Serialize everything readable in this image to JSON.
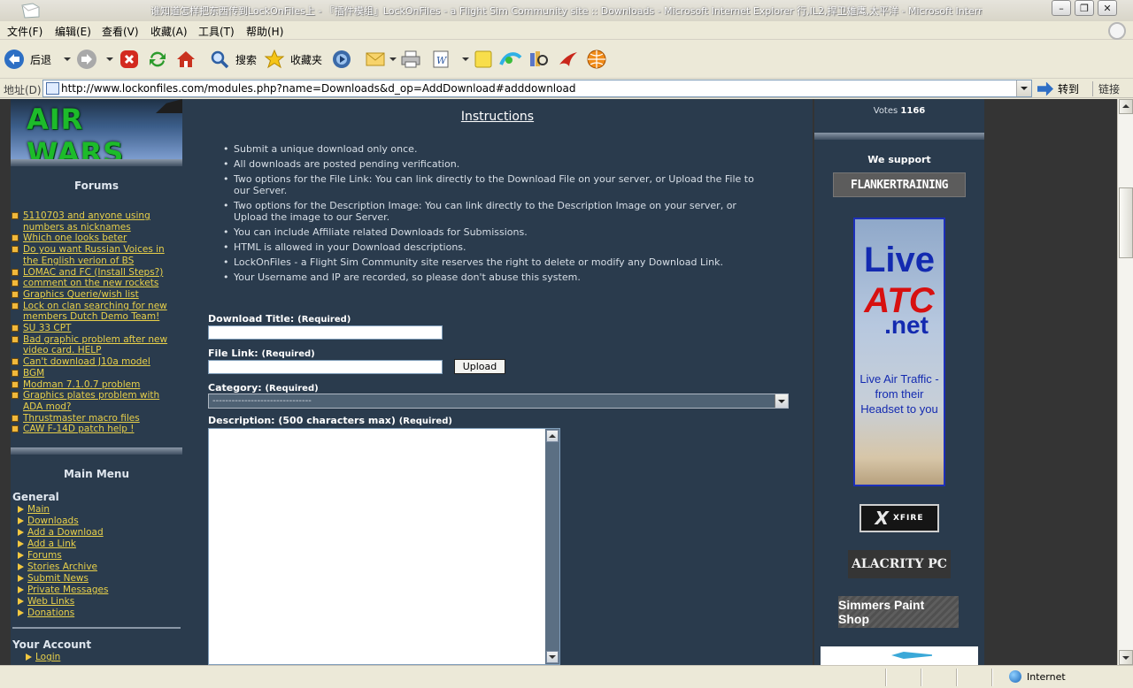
{
  "window": {
    "title": "谁知道怎样把东西传到LockOnFiles上 - 『插件模组』LockOnFiles - a Flight Sim Community site :: Downloads - Microsoft Internet Explorer 行,IL2,捍卫雄鹰,太平洋 - Microsoft Internet Explorer"
  },
  "menubar": [
    "文件(F)",
    "编辑(E)",
    "查看(V)",
    "收藏(A)",
    "工具(T)",
    "帮助(H)"
  ],
  "toolbar": {
    "back_label": "后退",
    "search_label": "搜索",
    "favorites_label": "收藏夹"
  },
  "address": {
    "label": "地址(D)",
    "url": "http://www.lockonfiles.com/modules.php?name=Downloads&d_op=AddDownload#adddownload",
    "go_label": "转到",
    "links_label": "链接"
  },
  "left": {
    "logo_text": "AIR WARS",
    "forums_title": "Forums",
    "forum_items": [
      "5110703 and anyone using numbers as nicknames",
      "Which one looks beter",
      "Do you want Russian Voices in the English verion of BS",
      "LOMAC and FC (Install Steps?)",
      "comment on the new rockets",
      "Graphics Querie/wish list",
      "Lock on clan searching for new members Dutch Demo Team!",
      "SU 33 CPT",
      "Bad graphic problem after new video card. HELP",
      "Can't download J10a model",
      "BGM",
      "Modman 7.1.0.7 problem",
      "Graphics plates problem with ADA mod?",
      "Thrustmaster macro files",
      "CAW F-14D patch help !"
    ],
    "main_menu_title": "Main Menu",
    "general_title": "General",
    "general_links": [
      "Main",
      "Downloads",
      "Add a Download",
      "Add a Link",
      "Forums",
      "Stories Archive",
      "Submit News",
      "Private Messages",
      "Web Links",
      "Donations"
    ],
    "account_title": "Your Account",
    "account_links": [
      "Login"
    ]
  },
  "center": {
    "instructions_title": "Instructions",
    "instructions": [
      "Submit a unique download only once.",
      "All downloads are posted pending verification.",
      "Two options for the File Link: You can link directly to the Download File on your server, or Upload the File to our Server.",
      "Two options for the Description Image: You can link directly to the Description Image on your server, or Upload the image to our Server.",
      "You can include Affiliate related Downloads for Submissions.",
      "HTML is allowed in your Download descriptions.",
      "LockOnFiles - a Flight Sim Community site reserves the right to delete or modify any Download Link.",
      "Your Username and IP are recorded, so please don't abuse this system."
    ],
    "form": {
      "title_label": "Download Title:",
      "title_req": "(Required)",
      "title_value": "",
      "filelink_label": "File Link:",
      "filelink_req": "(Required)",
      "filelink_value": "",
      "upload_label": "Upload",
      "category_label": "Category:",
      "category_req": "(Required)",
      "category_value": "-------------------------------",
      "description_label": "Description: (500 characters max)",
      "description_req": "(Required)",
      "description_value": ""
    }
  },
  "right": {
    "votes_label": "Votes",
    "votes_value": "1166",
    "support_title": "We support",
    "banners": {
      "flanker": "FLANKERTRAINING",
      "atc_live": "Live",
      "atc_atc": "ATC",
      "atc_net": ".net",
      "atc_tagline": "Live Air Traffic -from their Headset to you",
      "xfire": "XFIRE",
      "alacrity": "ALACRITY PC",
      "simmers": "Simmers Paint Shop"
    }
  },
  "statusbar": {
    "zone": "Internet"
  },
  "colors": {
    "page_bg": "#2a3b4d",
    "link": "#e8d04a",
    "frame": "#343434"
  }
}
